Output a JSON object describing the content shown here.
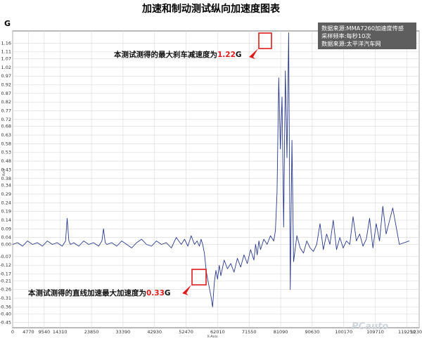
{
  "chart_data": {
    "type": "line",
    "title": "加速和制动测试纵向加速度图表",
    "y_unit": "G",
    "ylabel": "Axis",
    "xlabel": "X-Axis",
    "ylim": [
      -0.48,
      1.23
    ],
    "xlim": [
      0,
      123000
    ],
    "y_ticks": [
      "1.16",
      "1.11",
      "1.07",
      "1.02",
      "0.97",
      "0.92",
      "0.87",
      "0.82",
      "0.77",
      "0.72",
      "0.68",
      "0.63",
      "0.58",
      "0.53",
      "0.48",
      "0.43",
      "0.38",
      "0.34",
      "0.29",
      "0.24",
      "0.19",
      "0.14",
      "0.09",
      "0.04",
      "0.00",
      "-0.07",
      "-0.12",
      "-0.17",
      "-0.21",
      "-0.26",
      "-0.31",
      "-0.36",
      "-0.40",
      "-0.45"
    ],
    "x_ticks": [
      "0",
      "4770",
      "9540",
      "14310",
      "23850",
      "33390",
      "42930",
      "52470",
      "62010",
      "71550",
      "81090",
      "90630",
      "100170",
      "109710",
      "119250",
      "123000"
    ],
    "series": [
      {
        "color": "#2b3a8c",
        "x": [
          0,
          1500,
          3000,
          4500,
          6000,
          7500,
          9000,
          10500,
          12000,
          13500,
          15000,
          16000,
          16500,
          17000,
          17500,
          18500,
          20000,
          21500,
          23000,
          24500,
          26000,
          27000,
          27500,
          28000,
          28500,
          30000,
          31500,
          33000,
          34500,
          36000,
          37500,
          39000,
          40500,
          42000,
          43500,
          45000,
          46500,
          48000,
          49500,
          51000,
          52000,
          53000,
          54000,
          55000,
          55800,
          56500,
          57000,
          57500,
          58000,
          58600,
          59200,
          60000,
          60500,
          61000,
          61500,
          62000,
          62500,
          63000,
          64000,
          65000,
          66000,
          67000,
          68000,
          69000,
          70000,
          71000,
          72000,
          73000,
          73500,
          74000,
          74500,
          75000,
          76000,
          77000,
          78000,
          79000,
          79500,
          80000,
          80500,
          81000,
          81500,
          82000,
          82500,
          83000,
          83500,
          84000,
          84500,
          85000,
          86000,
          87000,
          88000,
          89000,
          90000,
          91000,
          92000,
          93000,
          94000,
          95000,
          96000,
          97000,
          98000,
          99000,
          100000,
          101000,
          102000,
          103000,
          104000,
          105000,
          106000,
          107000,
          108000,
          109000,
          110000,
          111000,
          112000,
          113000,
          115000,
          117000,
          120000
        ],
        "values": [
          0.0,
          0.01,
          -0.01,
          0.02,
          0.0,
          0.01,
          -0.01,
          0.02,
          0.0,
          0.01,
          -0.01,
          0.02,
          0.15,
          0.02,
          0.0,
          0.01,
          -0.01,
          0.02,
          0.0,
          0.01,
          -0.01,
          0.02,
          0.09,
          0.01,
          0.0,
          0.01,
          -0.01,
          0.02,
          0.0,
          -0.02,
          0.01,
          0.03,
          0.0,
          -0.01,
          0.02,
          0.0,
          0.01,
          -0.02,
          0.04,
          0.0,
          0.03,
          -0.01,
          0.05,
          0.0,
          0.02,
          -0.01,
          0.03,
          0.0,
          -0.05,
          -0.16,
          -0.22,
          -0.3,
          -0.36,
          -0.22,
          -0.15,
          -0.2,
          -0.12,
          -0.18,
          -0.09,
          -0.14,
          -0.11,
          -0.16,
          -0.08,
          -0.13,
          -0.06,
          -0.11,
          -0.03,
          -0.09,
          0.0,
          -0.06,
          0.02,
          -0.03,
          0.03,
          0.0,
          0.05,
          0.02,
          0.08,
          0.3,
          0.96,
          0.55,
          0.85,
          0.1,
          1.0,
          0.5,
          1.22,
          -0.26,
          0.6,
          -0.1,
          0.05,
          -0.02,
          -0.05,
          0.02,
          -0.02,
          -0.04,
          0.0,
          0.12,
          -0.03,
          0.06,
          0.0,
          0.14,
          -0.03,
          0.04,
          -0.02,
          0.02,
          0.0,
          0.16,
          0.02,
          0.06,
          -0.01,
          0.03,
          0.15,
          -0.02,
          0.12,
          0.02,
          0.22,
          0.06,
          0.21,
          0.0,
          0.02
        ]
      }
    ],
    "annotations": [
      {
        "text": "本测试测得的最大刹车减速度为",
        "value": "1.22",
        "unit": "G",
        "x": 81500,
        "y": 1.22
      },
      {
        "text": "本测试测得的直线加速最大加速度为",
        "value": "0.33",
        "unit": "G",
        "x": 60500,
        "y": -0.36
      }
    ],
    "info_box": [
      "数据来源:MMA7260加速度传感",
      "采样频率:每秒10次",
      "数据来源:太平洋汽车网"
    ],
    "grid": true
  },
  "watermark": "PCauto"
}
